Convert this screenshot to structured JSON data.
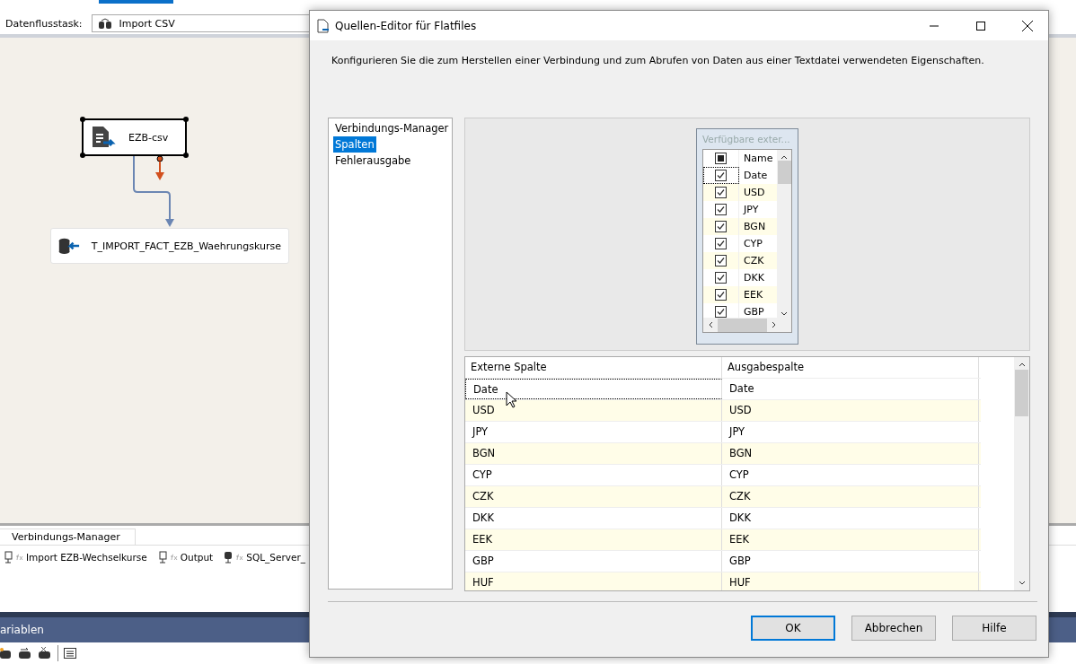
{
  "toolbar": {
    "label": "Datenflusstask:",
    "task": "Import CSV"
  },
  "canvas": {
    "nodes": [
      {
        "kind": "source",
        "label": "EZB-csv",
        "selected": true
      },
      {
        "kind": "destination",
        "label": "T_IMPORT_FACT_EZB_Waehrungskurse",
        "selected": false
      }
    ]
  },
  "connection_tabs": [
    {
      "label": "Verbindungs-Manager",
      "selected": true
    }
  ],
  "connections": [
    {
      "kind": "file",
      "label": "Import EZB-Wechselkurse"
    },
    {
      "kind": "file",
      "label": "Output"
    },
    {
      "kind": "database",
      "label": "SQL_Server_"
    }
  ],
  "variables_panel": {
    "title": "ariablen"
  },
  "dialog": {
    "title": "Quellen-Editor für Flatfiles",
    "description": "Konfigurieren Sie die zum Herstellen einer Verbindung und zum Abrufen von Daten aus einer Textdatei verwendeten Eigenschaften.",
    "nav": [
      {
        "label": "Verbindungs-Manager",
        "selected": false
      },
      {
        "label": "Spalten",
        "selected": true
      },
      {
        "label": "Fehlerausgabe",
        "selected": false
      }
    ],
    "available": {
      "title": "Verfügbare exter...",
      "header": "Name",
      "indeterminate": true,
      "rows": [
        {
          "name": "Date",
          "checked": true,
          "focused": true
        },
        {
          "name": "USD",
          "checked": true,
          "focused": false
        },
        {
          "name": "JPY",
          "checked": true,
          "focused": false
        },
        {
          "name": "BGN",
          "checked": true,
          "focused": false
        },
        {
          "name": "CYP",
          "checked": true,
          "focused": false
        },
        {
          "name": "CZK",
          "checked": true,
          "focused": false
        },
        {
          "name": "DKK",
          "checked": true,
          "focused": false
        },
        {
          "name": "EEK",
          "checked": true,
          "focused": false
        },
        {
          "name": "GBP",
          "checked": true,
          "focused": false
        }
      ]
    },
    "mapping": {
      "columns": [
        "Externe Spalte",
        "Ausgabespalte"
      ],
      "rows": [
        {
          "external": "Date",
          "output": "Date",
          "focused": true
        },
        {
          "external": "USD",
          "output": "USD",
          "focused": false
        },
        {
          "external": "JPY",
          "output": "JPY",
          "focused": false
        },
        {
          "external": "BGN",
          "output": "BGN",
          "focused": false
        },
        {
          "external": "CYP",
          "output": "CYP",
          "focused": false
        },
        {
          "external": "CZK",
          "output": "CZK",
          "focused": false
        },
        {
          "external": "DKK",
          "output": "DKK",
          "focused": false
        },
        {
          "external": "EEK",
          "output": "EEK",
          "focused": false
        },
        {
          "external": "GBP",
          "output": "GBP",
          "focused": false
        },
        {
          "external": "HUF",
          "output": "HUF",
          "focused": false
        }
      ]
    },
    "buttons": [
      {
        "label": "OK",
        "default": true
      },
      {
        "label": "Abbrechen",
        "default": false
      },
      {
        "label": "Hilfe",
        "default": false
      }
    ]
  }
}
